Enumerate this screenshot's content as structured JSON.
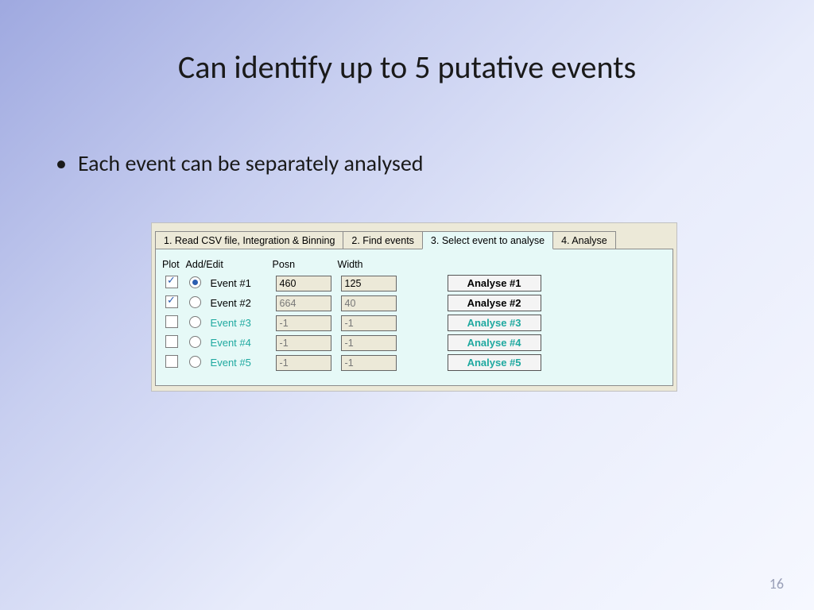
{
  "slide": {
    "title": "Can identify up to 5 putative events",
    "bullet": "Each event can be separately analysed",
    "page_number": "16"
  },
  "tabs": [
    "1.  Read CSV file, Integration & Binning",
    "2. Find events",
    "3. Select event to analyse",
    "4. Analyse"
  ],
  "active_tab_index": 2,
  "headers": {
    "plot": "Plot",
    "addedit": "Add/Edit",
    "posn": "Posn",
    "width": "Width"
  },
  "events": [
    {
      "plot_checked": true,
      "radio_selected": true,
      "label": "Event #1",
      "posn": "460",
      "width": "125",
      "analyse": "Analyse #1",
      "enabled": true
    },
    {
      "plot_checked": true,
      "radio_selected": false,
      "label": "Event #2",
      "posn": "664",
      "width": "40",
      "analyse": "Analyse #2",
      "enabled": true
    },
    {
      "plot_checked": false,
      "radio_selected": false,
      "label": "Event #3",
      "posn": "-1",
      "width": "-1",
      "analyse": "Analyse #3",
      "enabled": false
    },
    {
      "plot_checked": false,
      "radio_selected": false,
      "label": "Event #4",
      "posn": "-1",
      "width": "-1",
      "analyse": "Analyse #4",
      "enabled": false
    },
    {
      "plot_checked": false,
      "radio_selected": false,
      "label": "Event #5",
      "posn": "-1",
      "width": "-1",
      "analyse": "Analyse #5",
      "enabled": false
    }
  ]
}
